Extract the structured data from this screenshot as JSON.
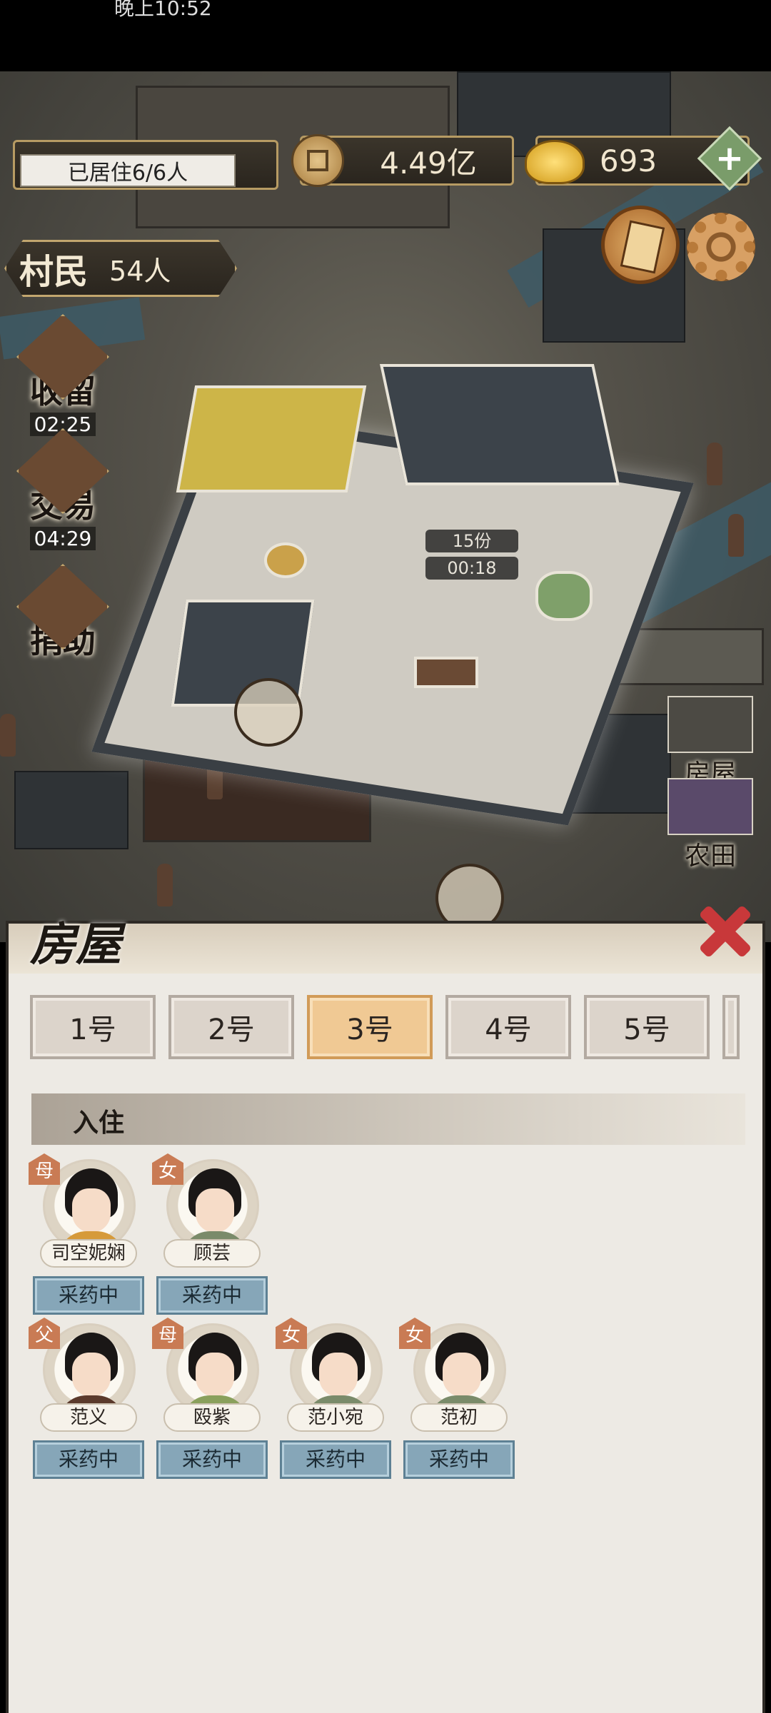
{
  "status_bar": {
    "time": "晚上10:52"
  },
  "hud": {
    "residence_label": "已居住6/6人",
    "copper": "4.49亿",
    "gold": "693",
    "plus": "+",
    "villager_label": "村民",
    "villager_count": "54人"
  },
  "left_buttons": [
    {
      "label": "收留",
      "timer": "02:25"
    },
    {
      "label": "交易",
      "timer": "04:29"
    },
    {
      "label": "捐助",
      "timer": ""
    }
  ],
  "right_buttons": [
    {
      "label": "房屋"
    },
    {
      "label": "农田"
    }
  ],
  "map_timers": {
    "portions": "15份",
    "time": "00:18"
  },
  "panel": {
    "title": "房屋",
    "tabs": [
      "1号",
      "2号",
      "3号",
      "4号",
      "5号"
    ],
    "active_tab": "3号",
    "section": "入住",
    "residents": [
      {
        "name": "司空妮娴",
        "tag": "母",
        "status": "采药中"
      },
      {
        "name": "顾芸",
        "tag": "女",
        "status": "采药中"
      },
      {
        "name": "范义",
        "tag": "父",
        "status": "采药中"
      },
      {
        "name": "殴紫",
        "tag": "母",
        "status": "采药中"
      },
      {
        "name": "范小宛",
        "tag": "女",
        "status": "采药中"
      },
      {
        "name": "范初",
        "tag": "女",
        "status": "采药中"
      }
    ]
  },
  "colors": {
    "accent": "#f0c994",
    "status_button": "#86a6b8",
    "close": "#c8383a"
  }
}
